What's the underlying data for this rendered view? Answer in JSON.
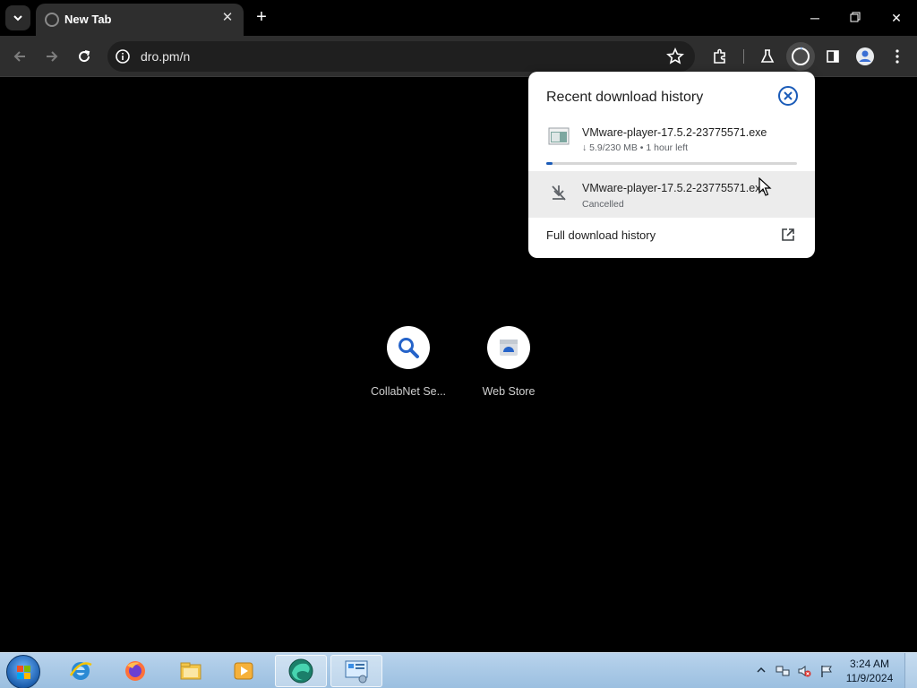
{
  "browser": {
    "tab": {
      "title": "New Tab"
    },
    "omnibox": {
      "url": "dro.pm/n"
    }
  },
  "download_bubble": {
    "title": "Recent download history",
    "items": [
      {
        "filename": "VMware-player-17.5.2-23775571.exe",
        "status": "↓ 5.9/230 MB • 1 hour left",
        "progress_percent": 2.6
      },
      {
        "filename": "VMware-player-17.5.2-23775571.exe",
        "status": "Cancelled"
      }
    ],
    "full_history_label": "Full download history"
  },
  "shortcuts": [
    {
      "label": "CollabNet Se...",
      "icon": "search-icon"
    },
    {
      "label": "Web Store",
      "icon": "web-store-icon"
    }
  ],
  "taskbar": {
    "pinned": [
      "internet-explorer-icon",
      "firefox-icon",
      "file-explorer-icon",
      "media-player-icon",
      "edge-app-icon",
      "control-panel-icon"
    ],
    "clock_time": "3:24 AM",
    "clock_date": "11/9/2024"
  },
  "colors": {
    "accent": "#1a5bb8",
    "toolbar": "#2e2e2e",
    "page_bg": "#000000"
  }
}
